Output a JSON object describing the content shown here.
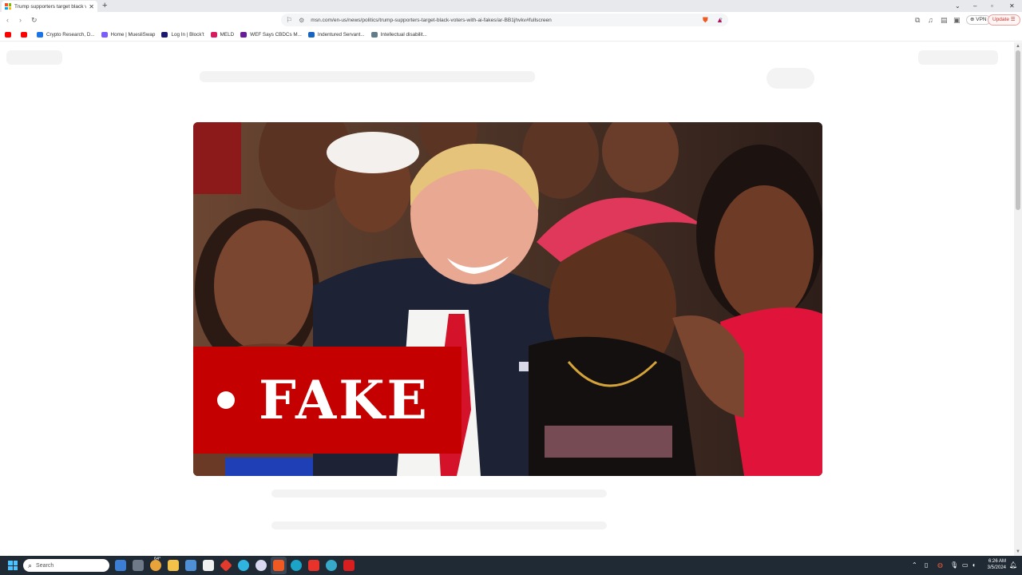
{
  "browser": {
    "tab": {
      "title": "Trump supporters target black vo"
    },
    "address": {
      "url": "msn.com/en-us/news/politics/trump-supporters-target-black-voters-with-ai-fakes/ar-BB1jhvkv#fullscreen"
    },
    "vpn_label": "VPN",
    "update_label": "Update",
    "bookmarks": [
      {
        "label": "",
        "color": "#ff0000"
      },
      {
        "label": "",
        "color": "#ff0000"
      },
      {
        "label": "Crypto Research, D...",
        "color": "#1a73e8"
      },
      {
        "label": "Home | MuesliSwap",
        "color": "#7b5cff"
      },
      {
        "label": "Log In | Block’t",
        "color": "#1a1a6e"
      },
      {
        "label": "MELD",
        "color": "#d81b60"
      },
      {
        "label": "WEF Says CBDCs M...",
        "color": "#6a1b9a"
      },
      {
        "label": "Indentured Servant...",
        "color": "#1565c0"
      },
      {
        "label": "Intellectual disabilit...",
        "color": "#607d8b"
      }
    ]
  },
  "article": {
    "image_label": "FAKE"
  },
  "taskbar": {
    "search_placeholder": "Search",
    "weather": "64°",
    "time": "6:26 AM",
    "date": "3/5/2024"
  }
}
